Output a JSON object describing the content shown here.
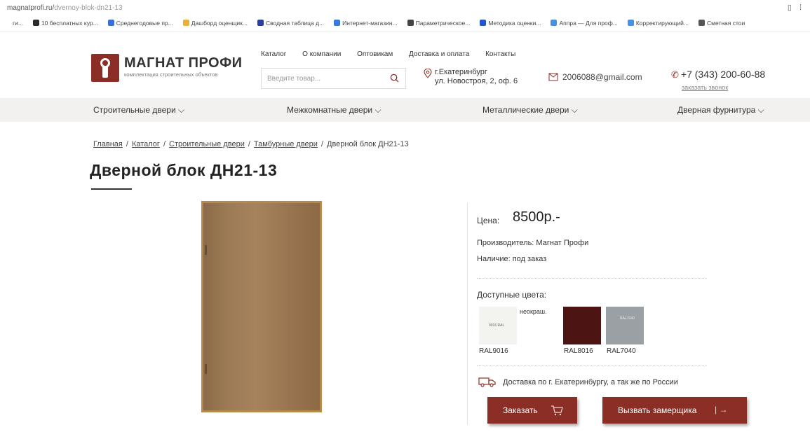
{
  "browser": {
    "url_host": "magnatprofi.ru/",
    "url_path": "dvernoy-blok-dn21-13",
    "bookmarks": [
      {
        "label": "ги...",
        "icon": "none-icon",
        "color": "#ffffff"
      },
      {
        "label": "10 бесплатных кур...",
        "icon": "course-icon",
        "color": "#2b2b2b"
      },
      {
        "label": "Среднегодовые пр...",
        "icon": "asterisk-icon",
        "color": "#3a6fd8"
      },
      {
        "label": "Дашборд оценщик...",
        "icon": "sun-icon",
        "color": "#e8b23a"
      },
      {
        "label": "Сводная таблица д...",
        "icon": "table-icon",
        "color": "#2a3fa0"
      },
      {
        "label": "Интернет-магазин...",
        "icon": "shop-icon",
        "color": "#3b7bd8"
      },
      {
        "label": "Параметрическое...",
        "icon": "doc-icon",
        "color": "#444444"
      },
      {
        "label": "Методика оценки...",
        "icon": "s-icon",
        "color": "#2456c8"
      },
      {
        "label": "Аппра — Для проф...",
        "icon": "a-icon",
        "color": "#4a90e2"
      },
      {
        "label": "Корректирующий...",
        "icon": "a-icon",
        "color": "#4a90e2"
      },
      {
        "label": "Сметная стои",
        "icon": "calc-icon",
        "color": "#555555"
      }
    ]
  },
  "brand": {
    "name": "МАГНАТ ПРОФИ",
    "tagline": "комплектация строительных объектов",
    "color": "#8b2e26"
  },
  "topnav": [
    "Каталог",
    "О компании",
    "Оптовикам",
    "Доставка и оплата",
    "Контакты"
  ],
  "search": {
    "placeholder": "Введите товар..."
  },
  "contacts": {
    "city": "г.Екатеринбург",
    "street": "ул. Новостроя, 2, оф. 6",
    "email": "2006088@gmail.com",
    "phone": "+7 (343) 200-60-88",
    "callback": "заказать звонок"
  },
  "categories": [
    "Строительные двери",
    "Межкомнатные двери",
    "Металлические двери",
    "Дверная фурнитура"
  ],
  "breadcrumbs": {
    "home": "Главная",
    "catalog": "Каталог",
    "section": "Строительные двери",
    "subsection": "Тамбурные двери",
    "current": "Дверной блок ДН21-13",
    "sep": "/"
  },
  "product": {
    "title": "Дверной блок ДН21-13",
    "price_label": "Цена:",
    "price": "8500р.-",
    "manufacturer": "Производитель: Магнат Профи",
    "availability": "Наличие: под заказ",
    "colors_title": "Доступные цвета:",
    "unpainted_note": "неокраш.",
    "swatches": [
      {
        "code": "RAL9016",
        "color": "#f3f3f0",
        "tag": "9016 RAL"
      },
      {
        "code": "RAL8016",
        "color": "#4d1414"
      },
      {
        "code": "RAL7040",
        "color": "#9aa0a4",
        "tag": "RAL7040"
      }
    ],
    "delivery": "Доставка по г. Екатеринбургу, а так же по России",
    "order_button": "Заказать",
    "measure_button": "Вызвать замерщика",
    "button_color": "#8b2e26"
  }
}
